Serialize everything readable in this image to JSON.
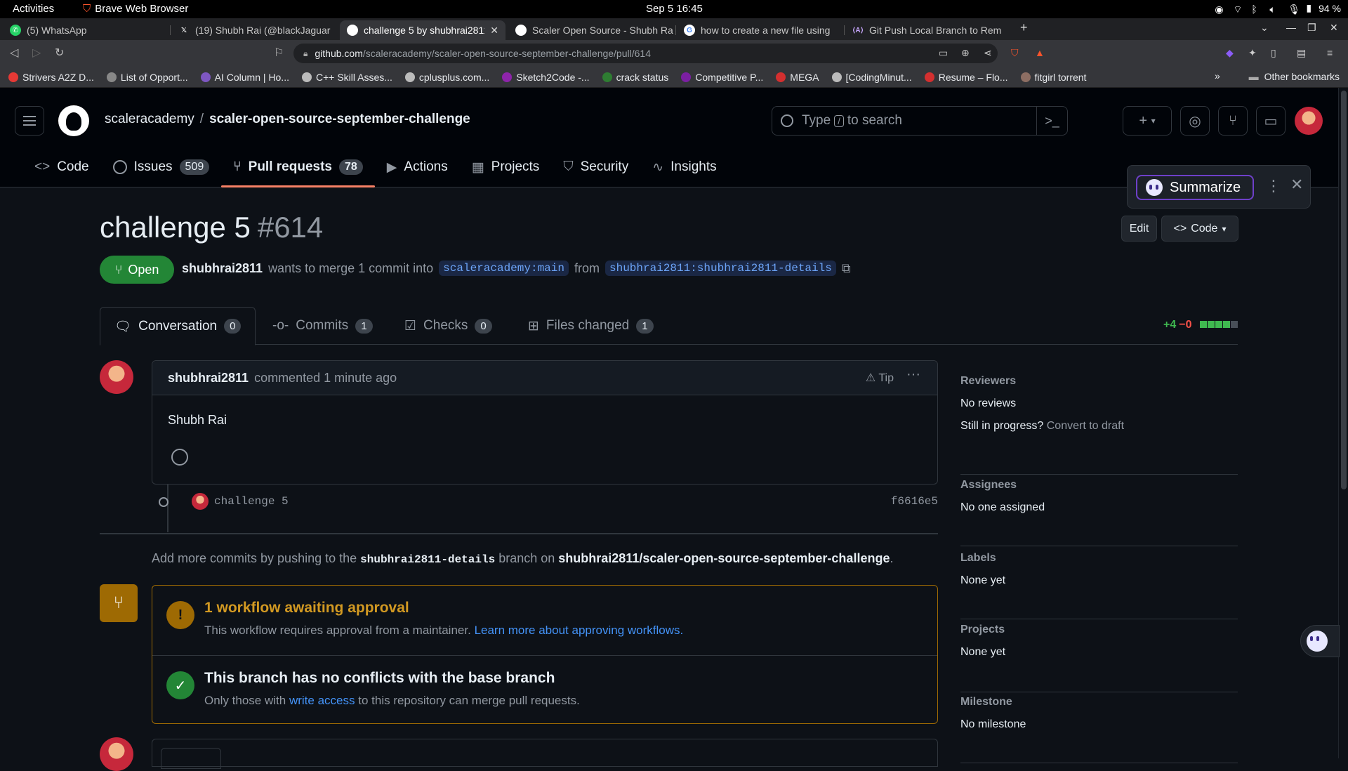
{
  "os": {
    "activities": "Activities",
    "app_name": "Brave Web Browser",
    "clock": "Sep 5  16:45",
    "battery": "94 %"
  },
  "tabs": [
    {
      "label": "(5) WhatsApp",
      "icon": "whatsapp-icon",
      "color": "#25d366"
    },
    {
      "label": "(19) Shubh Rai (@blackJaguar",
      "icon": "x-icon",
      "color": "#000000"
    },
    {
      "label": "challenge 5 by shubhrai2811",
      "icon": "github-icon",
      "color": "#ffffff",
      "active": true
    },
    {
      "label": "Scaler Open Source - Shubh Ra",
      "icon": "github-icon",
      "color": "#ffffff"
    },
    {
      "label": "how to create a new file using",
      "icon": "google-icon",
      "color": "#ffffff"
    },
    {
      "label": "Git Push Local Branch to Rem",
      "icon": "ai-icon",
      "color": "#ffffff"
    }
  ],
  "address": {
    "domain": "github.com",
    "path": "/scaleracademy/scaler-open-source-september-challenge/pull/614"
  },
  "bookmarks": [
    {
      "label": "Strivers A2Z D...",
      "color": "#e53935"
    },
    {
      "label": "List of Opport...",
      "color": "#888888"
    },
    {
      "label": "AI Column | Ho...",
      "color": "#7e57c2"
    },
    {
      "label": "C++ Skill Asses...",
      "color": "#bbbbbb"
    },
    {
      "label": "cplusplus.com...",
      "color": "#bbbbbb"
    },
    {
      "label": "Sketch2Code -...",
      "color": "#8e24aa"
    },
    {
      "label": "crack status",
      "color": "#2e7d32"
    },
    {
      "label": "Competitive P...",
      "color": "#7b1fa2"
    },
    {
      "label": "MEGA",
      "color": "#d32f2f"
    },
    {
      "label": "[CodingMinut...",
      "color": "#bbbbbb"
    },
    {
      "label": "Resume – Flo...",
      "color": "#d32f2f"
    },
    {
      "label": "fitgirl torrent",
      "color": "#8d6e63"
    }
  ],
  "bookmarks_more": "»",
  "other_bookmarks": "Other bookmarks",
  "repo": {
    "owner": "scaleracademy",
    "name": "scaler-open-source-september-challenge"
  },
  "search": {
    "prefix": "Type",
    "key": "/",
    "suffix": "to search"
  },
  "repo_tabs": [
    {
      "label": "Code",
      "icon": "code-icon"
    },
    {
      "label": "Issues",
      "count": "509",
      "icon": "issue-icon"
    },
    {
      "label": "Pull requests",
      "count": "78",
      "icon": "pull-request-icon",
      "active": true
    },
    {
      "label": "Actions",
      "icon": "play-icon"
    },
    {
      "label": "Projects",
      "icon": "table-icon"
    },
    {
      "label": "Security",
      "icon": "shield-icon"
    },
    {
      "label": "Insights",
      "icon": "graph-icon"
    }
  ],
  "summarize": {
    "label": "Summarize"
  },
  "pr": {
    "title": "challenge 5",
    "number": "#614",
    "state": "Open",
    "author": "shubhrai2811",
    "merge_text": "wants to merge 1 commit into",
    "base_branch": "scaleracademy:main",
    "from_text": "from",
    "head_branch": "shubhrai2811:shubhrai2811-details",
    "edit_label": "Edit",
    "code_label": "Code"
  },
  "conv_tabs": [
    {
      "label": "Conversation",
      "count": "0"
    },
    {
      "label": "Commits",
      "count": "1"
    },
    {
      "label": "Checks",
      "count": "0"
    },
    {
      "label": "Files changed",
      "count": "1"
    }
  ],
  "diffstat": {
    "additions": "+4",
    "deletions": "−0",
    "blocks_green": 4,
    "blocks_total": 5
  },
  "comment": {
    "author": "shubhrai2811",
    "meta": "commented 1 minute ago",
    "tip": "Tip",
    "body": "Shubh Rai"
  },
  "commit": {
    "message": "challenge 5",
    "sha": "f6616e5"
  },
  "hint": {
    "prefix": "Add more commits by pushing to the",
    "branch": "shubhrai2811-details",
    "middle": "branch on",
    "repo": "shubhrai2811/scaler-open-source-september-challenge",
    "suffix": "."
  },
  "merge": {
    "workflow_title": "1 workflow awaiting approval",
    "workflow_text": "This workflow requires approval from a maintainer.",
    "workflow_link": "Learn more about approving workflows.",
    "conflict_title": "This branch has no conflicts with the base branch",
    "conflict_prefix": "Only those with",
    "conflict_link": "write access",
    "conflict_suffix": "to this repository can merge pull requests."
  },
  "sidebar": {
    "reviewers_title": "Reviewers",
    "reviewers_value": "No reviews",
    "progress_q": "Still in progress?",
    "convert_link": "Convert to draft",
    "assignees_title": "Assignees",
    "assignees_value": "No one assigned",
    "labels_title": "Labels",
    "labels_value": "None yet",
    "projects_title": "Projects",
    "projects_value": "None yet",
    "milestone_title": "Milestone",
    "milestone_value": "No milestone"
  }
}
